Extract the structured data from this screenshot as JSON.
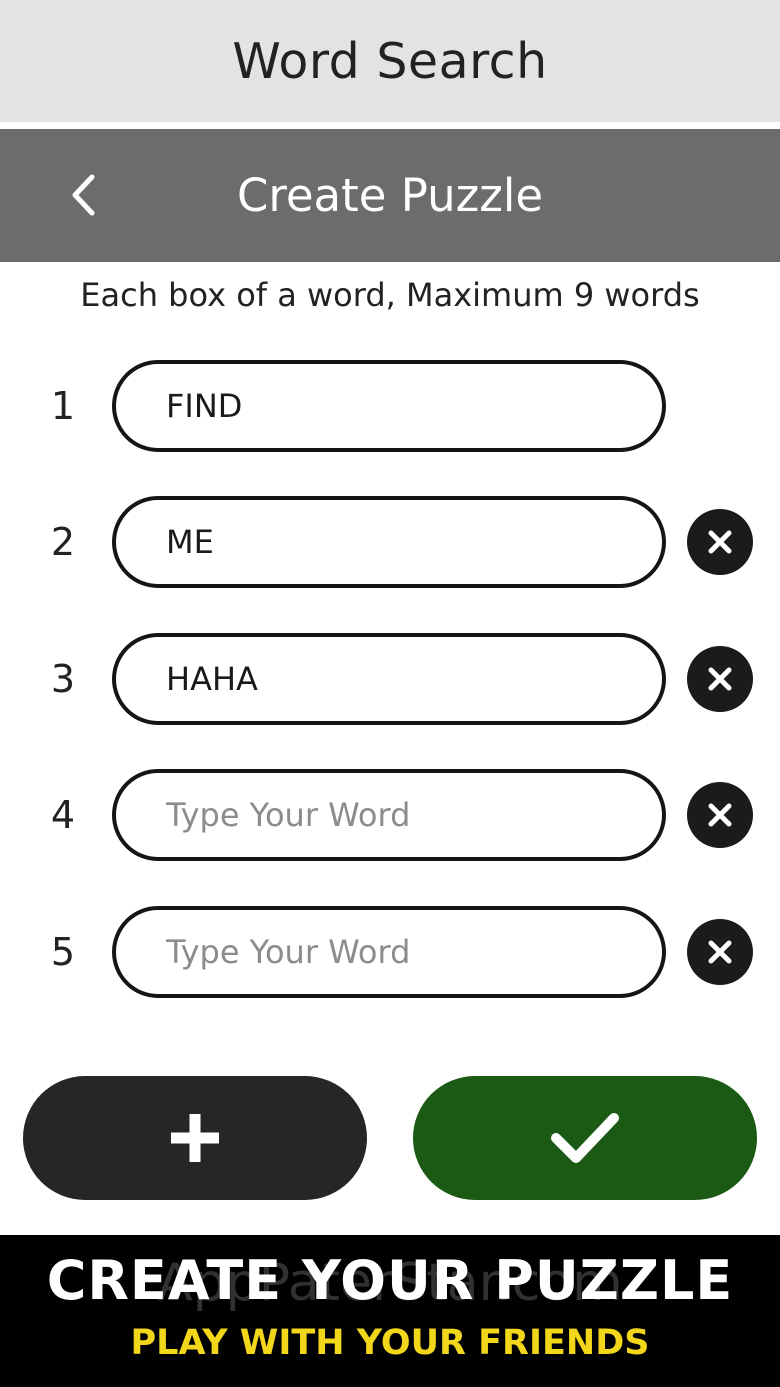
{
  "app": {
    "title": "Word Search"
  },
  "nav": {
    "title": "Create Puzzle",
    "back_icon": "chevron-left-icon"
  },
  "instruction": "Each box of a word, Maximum 9 words",
  "words": [
    {
      "number": "1",
      "value": "FIND",
      "placeholder": "Type Your Word",
      "removable": false
    },
    {
      "number": "2",
      "value": "ME",
      "placeholder": "Type Your Word",
      "removable": true
    },
    {
      "number": "3",
      "value": "HAHA",
      "placeholder": "Type Your Word",
      "removable": true
    },
    {
      "number": "4",
      "value": "",
      "placeholder": "Type Your Word",
      "removable": true
    },
    {
      "number": "5",
      "value": "",
      "placeholder": "Type Your Word",
      "removable": true
    }
  ],
  "actions": {
    "add_icon": "plus-icon",
    "confirm_icon": "checkmark-icon",
    "add_color": "#262626",
    "confirm_color": "#1b5a14"
  },
  "promo": {
    "headline": "CREATE YOUR PUZZLE",
    "subline": "PLAY WITH YOUR FRIENDS",
    "watermark": "AppPaterStar.com",
    "subline_color": "#f1d61a"
  }
}
